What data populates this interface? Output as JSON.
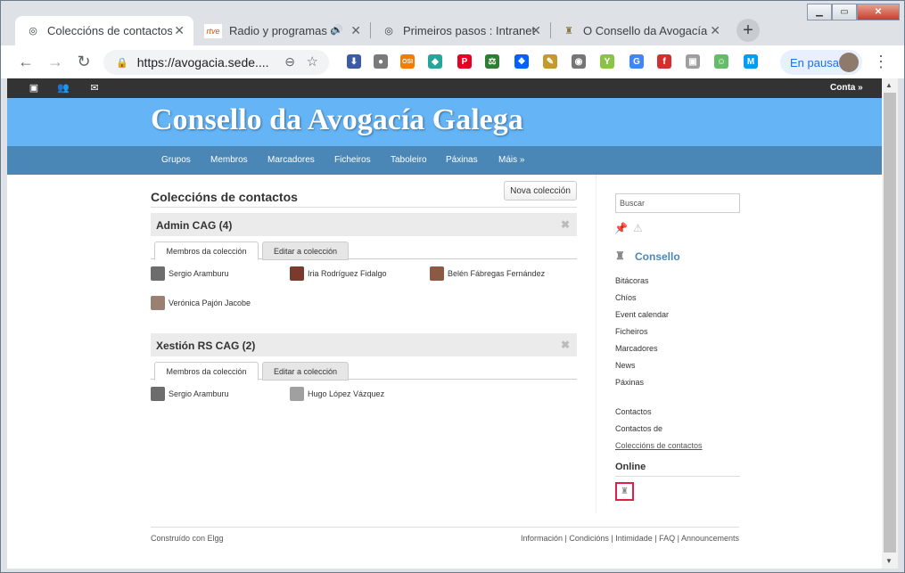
{
  "browser": {
    "tabs": [
      {
        "title": "Coleccións de contactos :",
        "icon": "elgg-icon",
        "active": true
      },
      {
        "title": "Radio y programas o",
        "icon": "rtve-icon",
        "badge": "rtve",
        "audio": true
      },
      {
        "title": "Primeiros pasos : Intranet",
        "icon": "elgg-icon"
      },
      {
        "title": "O Consello da Avogacía G",
        "icon": "crest-icon"
      }
    ],
    "url": "https://avogacia.sede....",
    "profile_label": "En pausa",
    "extensions": [
      {
        "name": "download-ext-icon",
        "color": "#3b5ba5",
        "glyph": "⬇"
      },
      {
        "name": "chat-ext-icon",
        "color": "#7a7a7a",
        "glyph": "●"
      },
      {
        "name": "osi-ext-icon",
        "color": "#f57c00",
        "glyph": "OSI"
      },
      {
        "name": "gem-ext-icon",
        "color": "#26a69a",
        "glyph": "◆"
      },
      {
        "name": "pinterest-ext-icon",
        "color": "#e60023",
        "glyph": "P"
      },
      {
        "name": "scale-ext-icon",
        "color": "#2e7d32",
        "glyph": "⚖"
      },
      {
        "name": "dropbox-ext-icon",
        "color": "#0061ff",
        "glyph": "❖"
      },
      {
        "name": "notes-ext-icon",
        "color": "#c49a2c",
        "glyph": "✎"
      },
      {
        "name": "camera-ext-icon",
        "color": "#757575",
        "glyph": "◉"
      },
      {
        "name": "y-ext-icon",
        "color": "#8bc34a",
        "glyph": "Y"
      },
      {
        "name": "translate-ext-icon",
        "color": "#4285f4",
        "glyph": "G"
      },
      {
        "name": "flash-ext-icon",
        "color": "#d32f2f",
        "glyph": "f"
      },
      {
        "name": "screen-ext-icon",
        "color": "#9e9e9e",
        "glyph": "▣"
      },
      {
        "name": "android-ext-icon",
        "color": "#66bb6a",
        "glyph": "☺"
      },
      {
        "name": "movistar-ext-icon",
        "color": "#019df4",
        "glyph": "M"
      }
    ]
  },
  "site": {
    "topbar": {
      "account": "Conta »"
    },
    "title": "Consello da Avogacía Galega",
    "nav": [
      "Grupos",
      "Membros",
      "Marcadores",
      "Ficheiros",
      "Taboleiro",
      "Páxinas",
      "Máis »"
    ]
  },
  "page": {
    "title": "Coleccións de contactos",
    "new_button": "Nova colección",
    "collections": [
      {
        "name": "Admin CAG (4)",
        "tab_members": "Membros da colección",
        "tab_edit": "Editar a colección",
        "members": [
          "Sergio Aramburu",
          "Iria Rodríguez Fidalgo",
          "Belén Fábregas Fernández",
          "Verónica Pajón Jacobe"
        ]
      },
      {
        "name": "Xestión RS CAG (2)",
        "tab_members": "Membros da colección",
        "tab_edit": "Editar a colección",
        "members": [
          "Sergio Aramburu",
          "Hugo López Vázquez"
        ]
      }
    ]
  },
  "sidebar": {
    "search_placeholder": "Buscar",
    "group_name": "Consello",
    "links": [
      "Bitácoras",
      "Chíos",
      "Event calendar",
      "Ficheiros",
      "Marcadores",
      "News",
      "Páxinas"
    ],
    "contacts_links": [
      "Contactos",
      "Contactos de",
      "Coleccións de contactos"
    ],
    "online_title": "Online"
  },
  "footer": {
    "left": "Construído con Elgg",
    "links": "Información | Condicións | Intimidade | FAQ | Announcements"
  }
}
